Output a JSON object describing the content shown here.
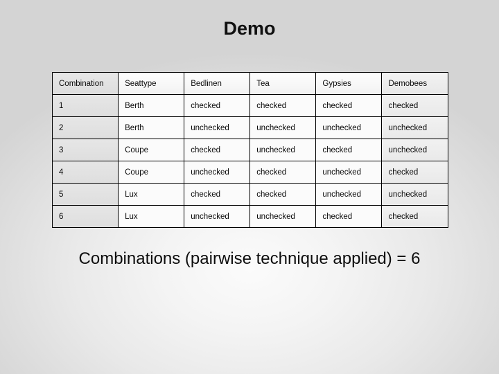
{
  "slide": {
    "title": "Demo",
    "caption": "Combinations (pairwise technique applied) = 6"
  },
  "table": {
    "headers": [
      "Combination",
      "Seattype",
      "Bedlinen",
      "Tea",
      "Gypsies",
      "Demobees"
    ],
    "rows": [
      [
        "1",
        "Berth",
        "checked",
        "checked",
        "checked",
        "checked"
      ],
      [
        "2",
        "Berth",
        "unchecked",
        "unchecked",
        "unchecked",
        "unchecked"
      ],
      [
        "3",
        "Coupe",
        "checked",
        "unchecked",
        "checked",
        "unchecked"
      ],
      [
        "4",
        "Coupe",
        "unchecked",
        "checked",
        "unchecked",
        "checked"
      ],
      [
        "5",
        "Lux",
        "checked",
        "checked",
        "unchecked",
        "unchecked"
      ],
      [
        "6",
        "Lux",
        "unchecked",
        "unchecked",
        "checked",
        "checked"
      ]
    ]
  },
  "colors": {
    "background_light": "#fbfbfb",
    "background_dark": "#d4d4d4",
    "border": "#000000",
    "text": "#0a0a0a",
    "column_tint": "#e3e3e3"
  }
}
